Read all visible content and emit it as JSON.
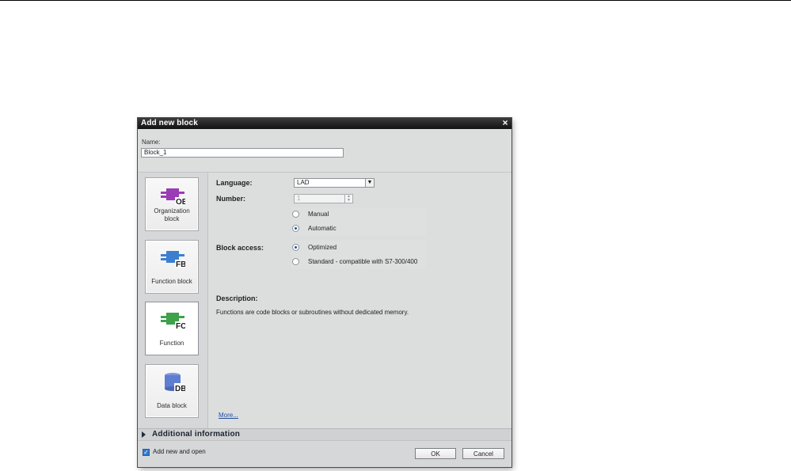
{
  "dialog": {
    "title": "Add new block",
    "close_icon": "close-icon",
    "name_label": "Name:",
    "name_value": "Block_1"
  },
  "blocks": [
    {
      "label": "Organization block",
      "icon": "organization-block-icon",
      "code": "OB",
      "color": "#9b3bb6"
    },
    {
      "label": "Function block",
      "icon": "function-block-icon",
      "code": "FB",
      "color": "#3c7fd0"
    },
    {
      "label": "Function",
      "icon": "function-icon",
      "code": "FC",
      "color": "#3da24a"
    },
    {
      "label": "Data block",
      "icon": "data-block-icon",
      "code": "DB",
      "color": "#5f7ecf"
    }
  ],
  "settings": {
    "language_label": "Language:",
    "language_value": "LAD",
    "number_label": "Number:",
    "number_value": "1",
    "number_modes": [
      {
        "label": "Manual",
        "checked": false
      },
      {
        "label": "Automatic",
        "checked": true
      }
    ],
    "block_access_label": "Block access:",
    "block_access_options": [
      {
        "label": "Optimized",
        "checked": true
      },
      {
        "label": "Standard - compatible with S7-300/400",
        "checked": false
      }
    ],
    "description_title": "Description:",
    "description_text": "Functions are code blocks or subroutines without dedicated memory.",
    "more_link": "More..."
  },
  "additional": {
    "label": "Additional  information",
    "icon": "arrow-right-icon"
  },
  "footer": {
    "checkbox_label": "Add new and open",
    "checkbox_checked": true,
    "ok": "OK",
    "cancel": "Cancel"
  },
  "colors": {
    "titlebar": "#1b1b1b",
    "dialog_background": "#d9dadb",
    "selection_blue": "#2f78d3",
    "link_blue": "#1f4e9f"
  }
}
